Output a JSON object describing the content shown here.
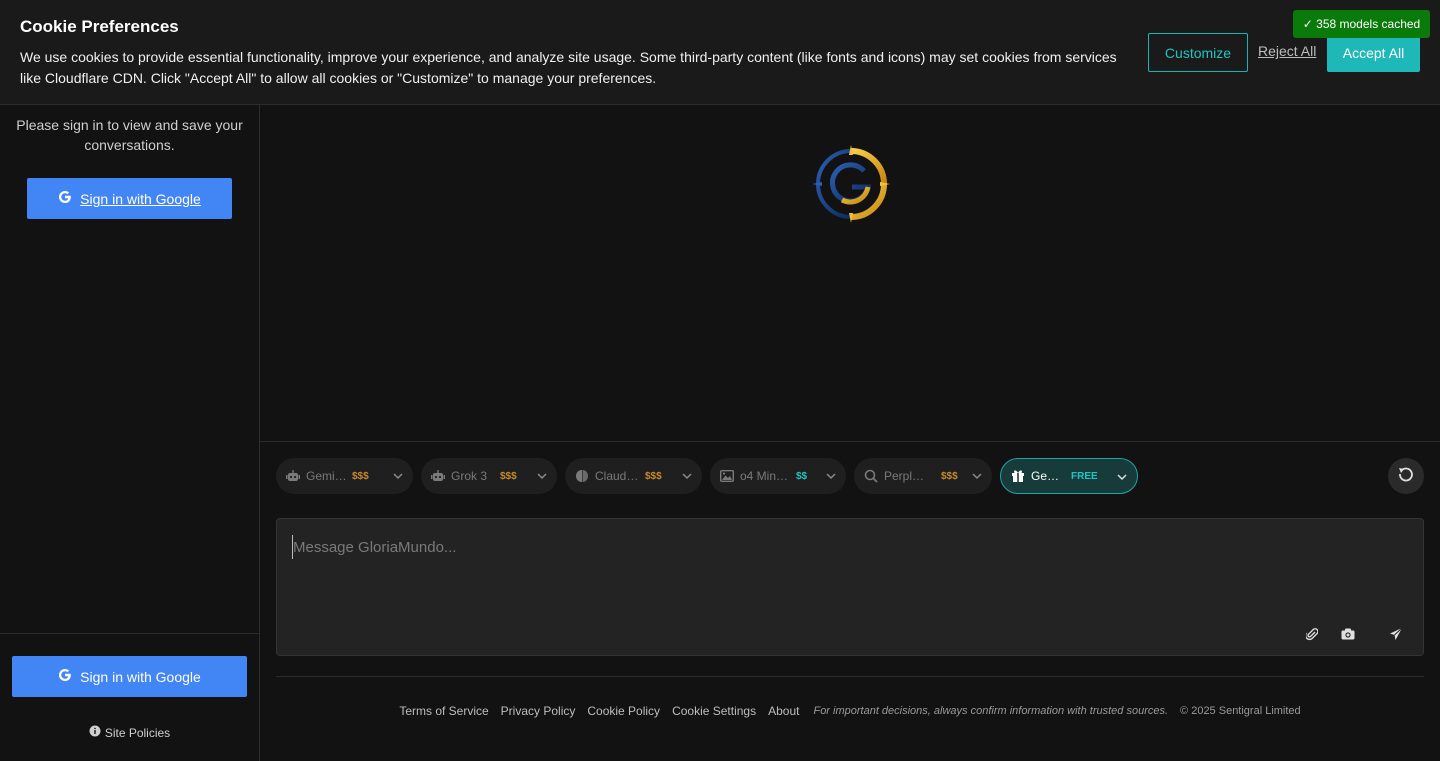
{
  "toast": {
    "text": "✓ 358 models cached",
    "color": "#0a7a0a"
  },
  "cookie": {
    "title": "Cookie Preferences",
    "text": "We use cookies to provide essential functionality, improve your experience, and analyze site usage. Some third-party content (like fonts and icons) may set cookies from services like Cloudflare CDN. Click \"Accept All\" to allow all cookies or \"Customize\" to manage your preferences.",
    "customize_label": "Customize",
    "reject_label": "Reject All",
    "accept_label": "Accept All",
    "accent": "#1fb8b8"
  },
  "sidebar": {
    "message": "Please sign in to view and save your conversations.",
    "google_top_label": "Sign in with Google",
    "google_bottom_label": "Sign in with Google",
    "site_policies_label": "Site Policies",
    "google_color": "#4285f4"
  },
  "models": [
    {
      "name": "Gemi…",
      "price": "$$$",
      "icon": "robot-icon"
    },
    {
      "name": "Grok 3",
      "price": "$$$",
      "icon": "robot-icon"
    },
    {
      "name": "Claud…",
      "price": "$$$",
      "icon": "brain-icon"
    },
    {
      "name": "o4 Min…",
      "price": "$$",
      "icon": "image-icon"
    },
    {
      "name": "Perpl…",
      "price": "$$$",
      "icon": "search-icon"
    },
    {
      "name": "Ge…",
      "price": "FREE",
      "icon": "gift-icon",
      "active": true
    }
  ],
  "composer": {
    "placeholder": "Message GloriaMundo..."
  },
  "footer": {
    "links": [
      "Terms of Service",
      "Privacy Policy",
      "Cookie Policy",
      "Cookie Settings",
      "About"
    ],
    "disclaimer": "For important decisions, always confirm information with trusted sources.",
    "copyright": "© 2025 Sentigral Limited"
  }
}
